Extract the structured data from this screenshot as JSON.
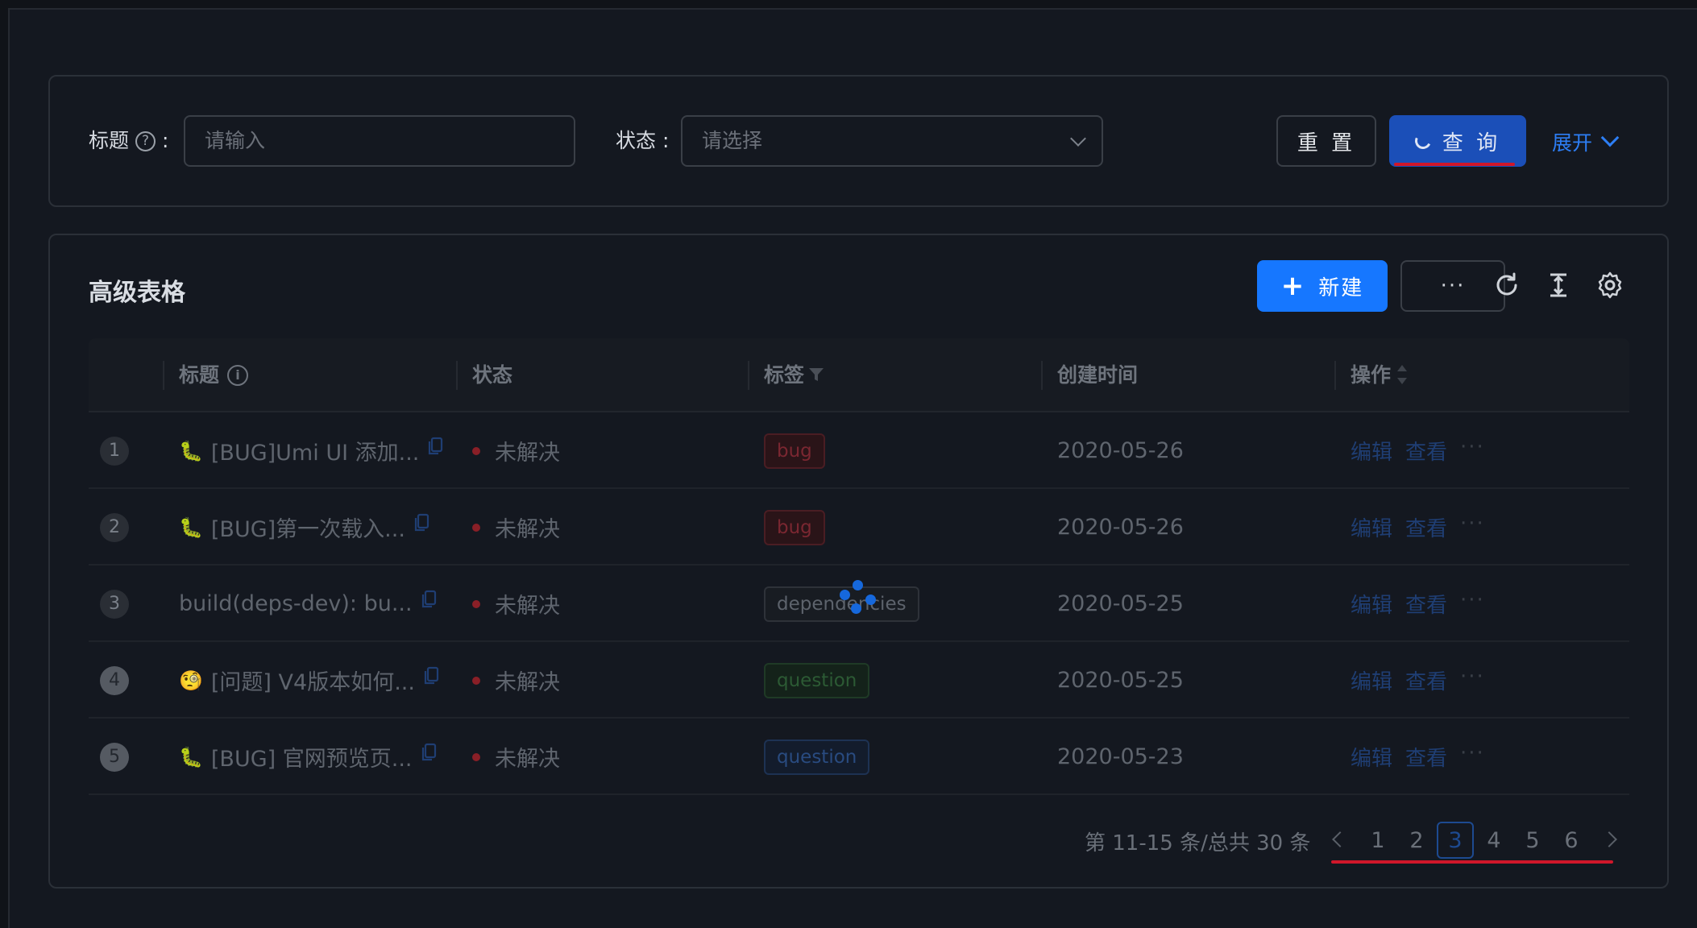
{
  "search": {
    "title_label": "标题",
    "title_placeholder": "请输入",
    "status_label": "状态",
    "status_placeholder": "请选择",
    "reset_label": "重 置",
    "query_label": "查 询",
    "expand_label": "展开"
  },
  "table": {
    "title": "高级表格",
    "new_label": "新建",
    "more_label": "···",
    "columns": [
      "标题",
      "状态",
      "标签",
      "创建时间",
      "操作"
    ],
    "rows": [
      {
        "index": "1",
        "emoji": "🐛",
        "title": "[BUG]Umi UI 添加...",
        "status": "未解决",
        "tag": "bug",
        "tag_style": "bug",
        "created": "2020-05-26",
        "edit": "编辑",
        "view": "查看",
        "more": "···"
      },
      {
        "index": "2",
        "emoji": "🐛",
        "title": "[BUG]第一次载入...",
        "status": "未解决",
        "tag": "bug",
        "tag_style": "bug",
        "created": "2020-05-26",
        "edit": "编辑",
        "view": "查看",
        "more": "···"
      },
      {
        "index": "3",
        "emoji": "",
        "title": "build(deps-dev): bu...",
        "status": "未解决",
        "tag": "dependencies",
        "tag_style": "dep",
        "created": "2020-05-25",
        "edit": "编辑",
        "view": "查看",
        "more": "···"
      },
      {
        "index": "4",
        "emoji": "🧐",
        "title": "[问题] V4版本如何...",
        "status": "未解决",
        "tag": "question",
        "tag_style": "q-green",
        "created": "2020-05-25",
        "edit": "编辑",
        "view": "查看",
        "more": "···"
      },
      {
        "index": "5",
        "emoji": "🐛",
        "title": "[BUG] 官网预览页...",
        "status": "未解决",
        "tag": "question",
        "tag_style": "q-blue",
        "created": "2020-05-23",
        "edit": "编辑",
        "view": "查看",
        "more": "···"
      }
    ]
  },
  "pagination": {
    "total_text": "第 11-15 条/总共 30 条",
    "pages": [
      "1",
      "2",
      "3",
      "4",
      "5",
      "6"
    ],
    "current": "3"
  },
  "colors": {
    "primary": "#1677ff",
    "loading_button": "#1b4fb8",
    "annotation_red": "#d0172a",
    "background": "#141820"
  }
}
